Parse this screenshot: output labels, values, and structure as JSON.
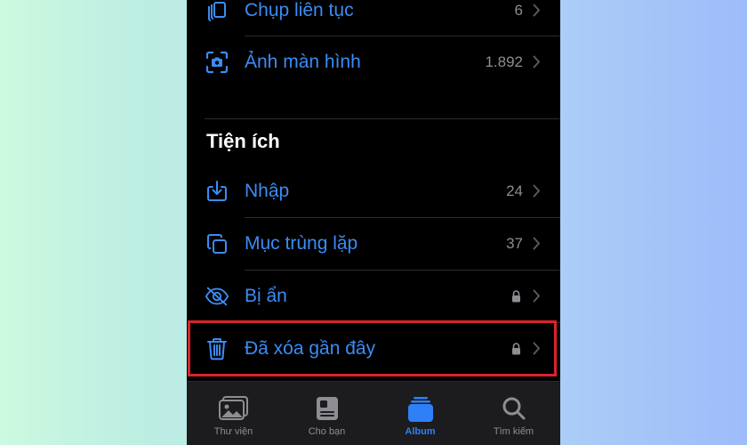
{
  "colors": {
    "accent": "#3b8cf5",
    "secondary_text": "#8d8d93",
    "highlight": "#d9232a",
    "background": "#000000"
  },
  "media_types": [
    {
      "label": "Chụp liên tục",
      "count": "6",
      "icon": "burst-icon"
    },
    {
      "label": "Ảnh màn hình",
      "count": "1.892",
      "icon": "screenshot-icon"
    }
  ],
  "utilities": {
    "title": "Tiện ích",
    "items": [
      {
        "label": "Nhập",
        "count": "24",
        "icon": "import-icon"
      },
      {
        "label": "Mục trùng lặp",
        "count": "37",
        "icon": "duplicates-icon"
      },
      {
        "label": "Bị ẩn",
        "count": "",
        "icon": "eye-slash-icon",
        "locked": true
      },
      {
        "label": "Đã xóa gần đây",
        "count": "",
        "icon": "trash-icon",
        "locked": true
      }
    ]
  },
  "tabbar": {
    "tabs": [
      {
        "label": "Thư viện",
        "icon": "photos-library-icon"
      },
      {
        "label": "Cho bạn",
        "icon": "for-you-icon"
      },
      {
        "label": "Album",
        "icon": "albums-icon",
        "active": true
      },
      {
        "label": "Tìm kiếm",
        "icon": "search-icon"
      }
    ]
  }
}
